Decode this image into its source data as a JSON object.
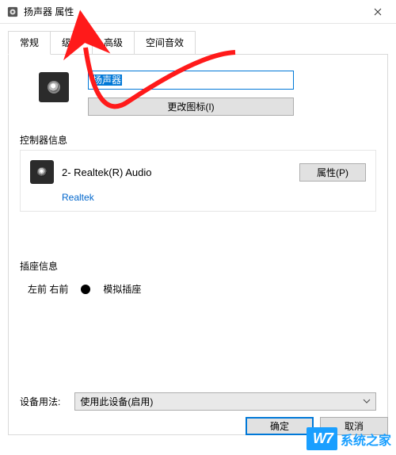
{
  "window": {
    "title": "扬声器 属性"
  },
  "tabs": [
    "常规",
    "级别",
    "高级",
    "空间音效"
  ],
  "device": {
    "name": "扬声器",
    "change_icon_btn": "更改图标(I)"
  },
  "controller": {
    "group_title": "控制器信息",
    "name": "2- Realtek(R) Audio",
    "vendor_link": "Realtek",
    "properties_btn": "属性(P)"
  },
  "jack": {
    "group_title": "插座信息",
    "position": "左前 右前",
    "type": "模拟插座"
  },
  "usage": {
    "label": "设备用法:",
    "selected": "使用此设备(启用)"
  },
  "footer": {
    "ok": "确定",
    "cancel": "取消"
  },
  "watermark": {
    "badge": "W7",
    "text": "系统之家"
  }
}
